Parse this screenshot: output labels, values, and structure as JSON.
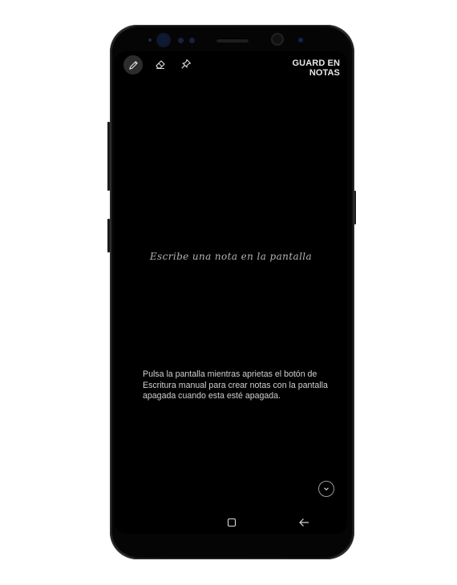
{
  "toolbar": {
    "tools": [
      {
        "icon": "pen-icon",
        "active": true
      },
      {
        "icon": "eraser-icon",
        "active": false
      },
      {
        "icon": "pin-icon",
        "active": false
      }
    ],
    "save_label": "GUARD EN NOTAS"
  },
  "canvas": {
    "placeholder": "Escribe una nota en la pantalla",
    "instructions": "Pulsa la pantalla mientras aprietas el botón de Escritura manual para crear notas con la pantalla apagada cuando esta esté apagada."
  },
  "controls": {
    "expand_icon": "chevron-down-circle-icon"
  },
  "navbar": {
    "recent_icon": "recent-apps-icon",
    "back_icon": "back-arrow-icon"
  },
  "colors": {
    "screen_bg": "#000000",
    "text_primary": "#e8e8e8",
    "text_hint": "#b4b4b4",
    "active_tool_bg": "#2c2c2e"
  }
}
